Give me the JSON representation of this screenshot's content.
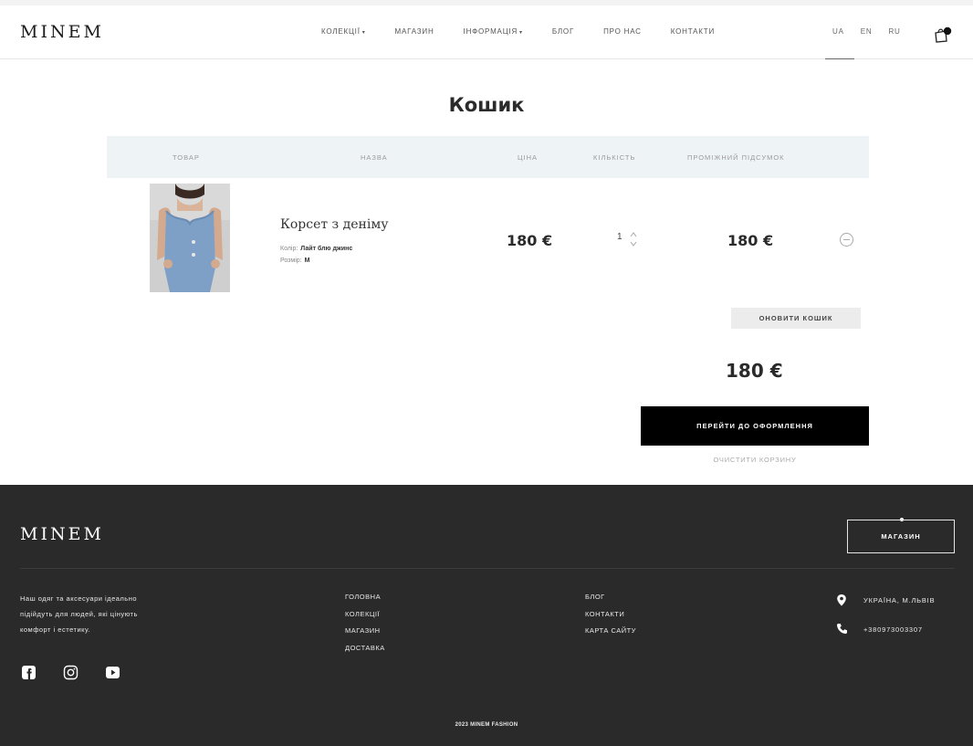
{
  "header": {
    "logo": "MINEM",
    "nav": [
      "КОЛЕКЦІЇ",
      "МАГАЗИН",
      "ІНФОРМАЦІЯ",
      "БЛОГ",
      "ПРО НАС",
      "КОНТАКТИ"
    ],
    "langs": [
      "UA",
      "EN",
      "RU"
    ],
    "active_lang": "UA",
    "cart_icon": "shopping-bag-icon"
  },
  "page_title": "Кошик",
  "table": {
    "headers": [
      "ТОВАР",
      "НАЗВА",
      "ЦІНА",
      "КІЛЬКІСТЬ",
      "ПРОМІЖНИЙ ПІДСУМОК"
    ]
  },
  "cart_item": {
    "name": "Корсет з деніму",
    "color_label": "Колір:",
    "color_value": "Лайт блю джинс",
    "size_label": "Розмір:",
    "size_value": "M",
    "price": "180 €",
    "quantity": "1",
    "subtotal": "180 €"
  },
  "update_button": "ОНОВИТИ КОШИК",
  "total": "180 €",
  "checkout_button": "ПЕРЕЙТИ ДО ОФОРМЛЕННЯ",
  "clear_cart": "ОЧИСТИТИ КОРЗИНУ",
  "footer": {
    "logo": "MINEM",
    "shops_button": "МАГАЗИН",
    "about": "Наш одяг та аксесуари ідеально підійдуть для людей, які цінують комфорт і естетику.",
    "col1": [
      "ГОЛОВНА",
      "КОЛЕКЦІЇ",
      "МАГАЗИН",
      "ДОСТАВКА"
    ],
    "col2": [
      "БЛОГ",
      "КОНТАКТИ",
      "КАРТА САЙТУ"
    ],
    "address": "УКРАЇНА, М.ЛЬВІВ",
    "phone": "+380973003307",
    "copyright": "2023 MINEM FASHION"
  },
  "colors": {
    "accent": "#000000",
    "footer_bg": "#2a2a2a",
    "table_header_bg": "#eef3f6"
  }
}
